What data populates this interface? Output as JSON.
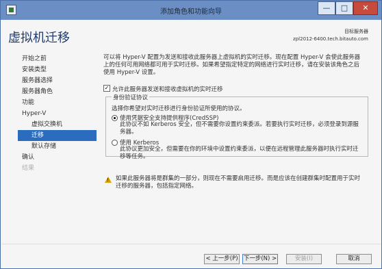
{
  "window": {
    "title": "添加角色和功能向导",
    "minimize": "—",
    "maximize": "□",
    "close": "✕"
  },
  "header": {
    "page_title": "虚拟机迁移",
    "server_label": "目标服务器",
    "server_name": "zpl2012-6400.tech.bitauto.com"
  },
  "nav": [
    {
      "label": "开始之前",
      "state": "normal",
      "level": 0
    },
    {
      "label": "安装类型",
      "state": "normal",
      "level": 0
    },
    {
      "label": "服务器选择",
      "state": "normal",
      "level": 0
    },
    {
      "label": "服务器角色",
      "state": "normal",
      "level": 0
    },
    {
      "label": "功能",
      "state": "normal",
      "level": 0
    },
    {
      "label": "Hyper-V",
      "state": "normal",
      "level": 0
    },
    {
      "label": "虚拟交换机",
      "state": "normal",
      "level": 1
    },
    {
      "label": "迁移",
      "state": "active",
      "level": 1
    },
    {
      "label": "默认存储",
      "state": "normal",
      "level": 1
    },
    {
      "label": "确认",
      "state": "normal",
      "level": 0
    },
    {
      "label": "结果",
      "state": "disabled",
      "level": 0
    }
  ],
  "content": {
    "intro": "可以将 Hyper-V 配置为发送和接收此服务器上虚拟机的实时迁移。现在配置 Hyper-V 会使此服务器上的任何可用网络都可用于实时迁移。如果希望指定特定的网络进行实时迁移，请在安装该角色之后使用 Hyper-V 设置。",
    "checkbox_label": "允许此服务器发送和接收虚拟机的实时迁移",
    "checkbox_checked": true,
    "group_title": "身份验证协议",
    "group_desc": "选择你希望对实时迁移进行身份验证所使用的协议。",
    "option1_label": "使用凭据安全支持提供程序(CredSSP)",
    "option1_desc": "此协议不如 Kerberos 安全，但不需要你设置约束委派。若要执行实时迁移，必须登录到源服务器。",
    "option2_label": "使用 Kerberos",
    "option2_desc": "此协议更加安全，但需要在你的环境中设置约束委派，以便在远程管理此服务器时执行实时迁移等任务。",
    "selected_option": 1,
    "warning_text": "如果此服务器将是群集的一部分，则现在不需要启用迁移。而是应该在创建群集时配置用于实时迁移的服务器，包括指定网络。"
  },
  "footer": {
    "prev": "< 上一步(P)",
    "next": "下一步(N) >",
    "install": "安装(I)",
    "cancel": "取消"
  }
}
